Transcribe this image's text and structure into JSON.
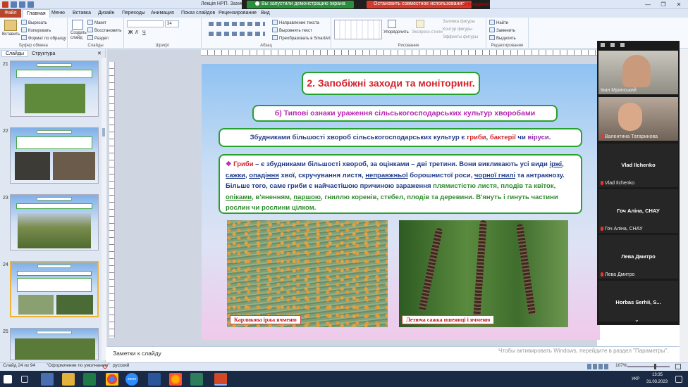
{
  "window": {
    "doc_title": "Лекція НРП. Захист р",
    "share_status": "Вы запустили демонстрацию экрана",
    "stop_share": "Остановить совместное использование",
    "product_text": "ак продукта!",
    "minimize": "—",
    "restore": "❐",
    "close": "✕"
  },
  "ribbon_tabs": [
    "Файл",
    "Главная",
    "Меню",
    "Вставка",
    "Дизайн",
    "Переходы",
    "Анимация",
    "Показ слайдов",
    "Рецензирование",
    "Вид"
  ],
  "ribbon": {
    "clipboard": {
      "label": "Буфер обмена",
      "paste": "Вставить",
      "cut": "Вырезать",
      "copy": "Копировать",
      "format": "Формат по образцу"
    },
    "slides": {
      "label": "Слайды",
      "create": "Создать слайд",
      "layout": "Макет",
      "reset": "Восстановить",
      "section": "Раздел"
    },
    "font": {
      "label": "Шрифт",
      "name": "",
      "size": "34"
    },
    "paragraph": {
      "label": "Абзац",
      "direction": "Направление текста",
      "align": "Выровнять текст",
      "smartart": "Преобразовать в SmartArt"
    },
    "drawing": {
      "label": "Рисование",
      "arrange": "Упорядочить",
      "styles": "Экспресс-стили",
      "fill": "Заливка фигуры",
      "outline": "Контур фигуры",
      "effects": "Эффекты фигуры"
    },
    "editing": {
      "label": "Редактирование",
      "find": "Найти",
      "replace": "Заменить",
      "select": "Выделить"
    }
  },
  "left_panel": {
    "tabs": [
      "Слайды",
      "Структура"
    ],
    "slides": [
      {
        "num": "21",
        "selected": false
      },
      {
        "num": "22",
        "selected": false
      },
      {
        "num": "23",
        "selected": false
      },
      {
        "num": "24",
        "selected": true
      },
      {
        "num": "25",
        "selected": false
      }
    ]
  },
  "slide": {
    "title": "2. Запобіжні заходи та моніторинг.",
    "subtitle": "б) Типові ознаки ураження сільськогосподарських культур хворобами",
    "intro": {
      "p1": "Збудниками більшості хвороб сільськогосподарських культур є ",
      "fungi": "гриби",
      "sep1": ", ",
      "bacteria": "бактерії",
      "sep2": " чи ",
      "viruses": "віруси",
      "end": "."
    },
    "bullet": "❖",
    "main": {
      "t1": "Гриби",
      "t2": " – є збудниками більшості хвороб, за оцінками – дві третини. Вони викликають усі види ",
      "t3": "іржі",
      "t4": ", ",
      "t5": "сажки",
      "t6": ", ",
      "t7": "опадіння",
      "t8": " хвої, скручування листя, ",
      "t9": "неправжньої",
      "t10": " борошнистої роси, ",
      "t11": "чорної гнилі",
      "t12": " та антракнозу. Більше того, саме гриби є найчастішою причиною зараження ",
      "t13": "плямистістю",
      "t14": " листя, плодів та квіток, ",
      "t15": "опіками",
      "t16": ", в'яненням, ",
      "t17": "паршою",
      "t18": ", гниллю коренів, стебел, плодів та деревини. В'януть і гинуть частини рослин чи рослини цілком."
    },
    "photo1_caption": "Карликова іржа ячменю",
    "photo2_caption": "Летюча сажка пшениці і ячменю"
  },
  "participants": [
    {
      "name": "Іван Мринський",
      "video": true
    },
    {
      "name": "Валентина Татаринова",
      "video": true
    },
    {
      "name": "Vlad Ilchenko",
      "video": false
    },
    {
      "name": "Гоч Аліна, СНАУ",
      "video": false
    },
    {
      "name": "Лева Дмитро",
      "video": false
    },
    {
      "name": "Horbas Serhii, S...",
      "video": false
    }
  ],
  "notes": {
    "placeholder": "Заметки к слайду",
    "activate": "Чтобы активировать Windows, перейдите в раздел \"Параметры\"."
  },
  "status": {
    "slide": "Слайд 24 из 94",
    "theme": "\"Оформление по умолчанию\"",
    "lang": "русский",
    "zoom": "107%"
  },
  "taskbar": {
    "lang": "УКР",
    "time": "13:35",
    "date": "31.03.2023",
    "zoom_label": "zoom"
  },
  "colors": {
    "accent": "#b7472a",
    "slide_border": "#27a12d",
    "title": "#d4232a",
    "subtitle": "#b524b0",
    "body": "#1e3a8a"
  }
}
